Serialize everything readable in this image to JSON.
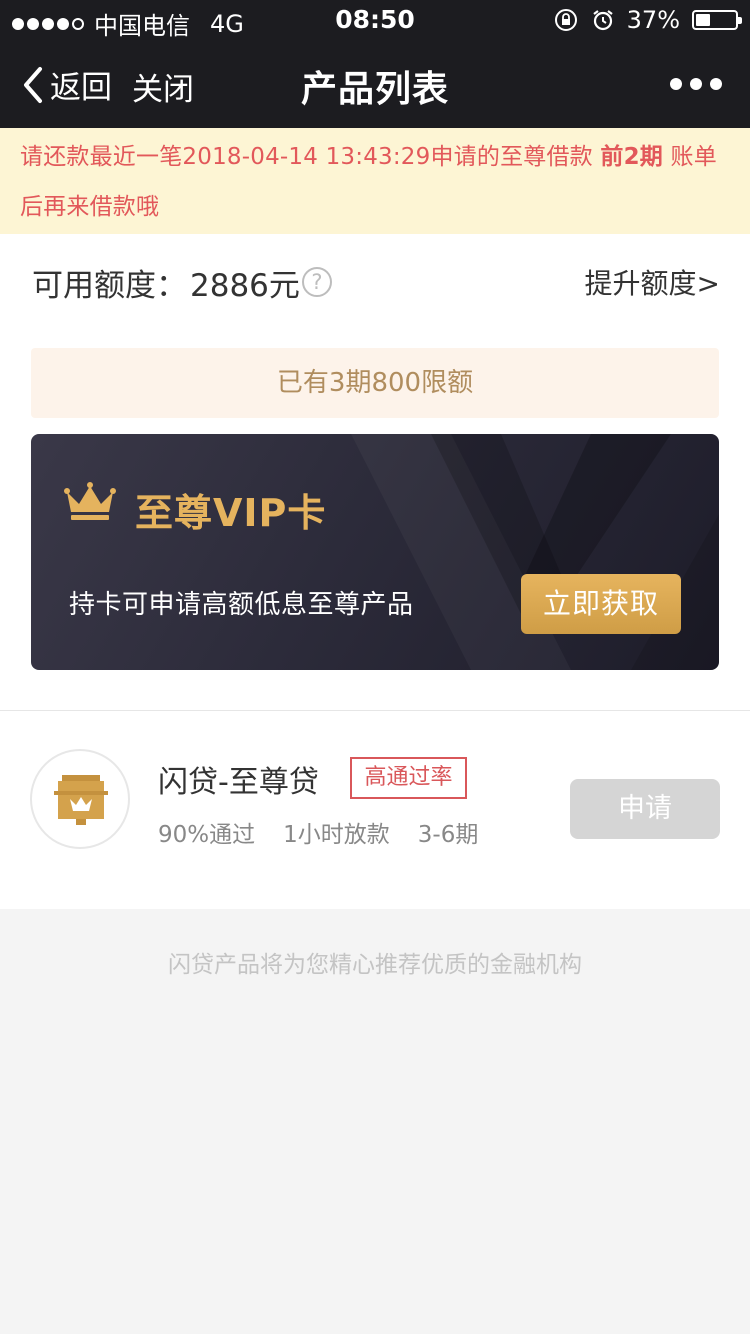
{
  "status_bar": {
    "carrier": "中国电信",
    "network": "4G",
    "time": "08:50",
    "battery": "37%",
    "battery_level": 0.37
  },
  "nav": {
    "back_label": "返回",
    "close_label": "关闭",
    "title": "产品列表"
  },
  "notice": {
    "text_before": "请还款最近一笔2018-04-14 13:43:29申请的至尊借款 ",
    "highlight": "前2期",
    "text_after": " 账单后再来借款哦"
  },
  "credit": {
    "label": "可用额度：",
    "value": "2886元",
    "help_symbol": "?",
    "raise_link": "提升额度>"
  },
  "limit_banner": "已有3期800限额",
  "vip_card": {
    "title": "至尊VIP卡",
    "description": "持卡可申请高额低息至尊产品",
    "button": "立即获取"
  },
  "product": {
    "name": "闪贷-至尊贷",
    "tag": "高通过率",
    "meta": [
      "90%通过",
      "1小时放款",
      "3-6期"
    ],
    "apply_button": "申请"
  },
  "footer": "闪贷产品将为您精心推荐优质的金融机构",
  "colors": {
    "nav_bg": "#1c1c20",
    "notice_bg": "#fdf5d4",
    "notice_text": "#e2585a",
    "gold": "#e5b35e",
    "tag_red": "#d9575a"
  }
}
